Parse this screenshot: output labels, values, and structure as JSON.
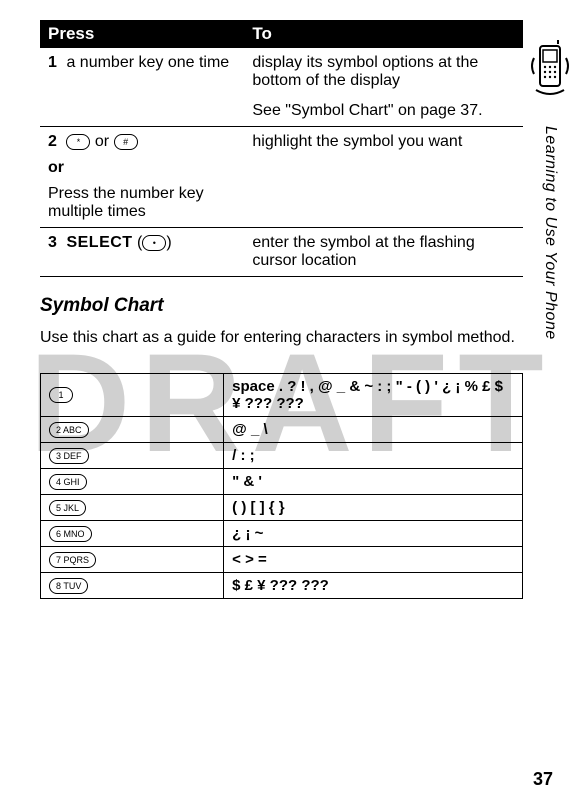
{
  "watermark": "DRAFT",
  "sideText": "Learning to Use Your Phone",
  "pageNumber": "37",
  "pressTable": {
    "headers": {
      "press": "Press",
      "to": "To"
    },
    "rows": [
      {
        "num": "1",
        "press": "a number key one time",
        "to": "display its symbol options at the bottom of the display",
        "to2": "See \"Symbol Chart\" on page 37."
      },
      {
        "num": "2",
        "keyLeft": "*",
        "keyJoin": " or ",
        "keyRight": "#",
        "orText": "or",
        "press2": "Press the number key multiple times",
        "to": "highlight the symbol you want"
      },
      {
        "num": "3",
        "select": "SELECT",
        "selectKey": "•",
        "to": "enter the symbol at the flashing cursor location"
      }
    ]
  },
  "sectionTitle": "Symbol Chart",
  "sectionDesc": "Use this chart as a guide for entering characters in symbol method.",
  "symbolTable": [
    {
      "key": "1",
      "symbols": "space . ? ! , @ _ & ~ : ; \" - ( ) ' ¿ ¡ % £ $ ¥ ??? ???"
    },
    {
      "key": "2 ABC",
      "symbols": "@ _ \\"
    },
    {
      "key": "3 DEF",
      "symbols": "/ : ;"
    },
    {
      "key": "4 GHI",
      "symbols": "\" & '"
    },
    {
      "key": "5 JKL",
      "symbols": "( ) [ ] { }"
    },
    {
      "key": "6 MNO",
      "symbols": "¿ ¡ ~"
    },
    {
      "key": "7 PQRS",
      "symbols": "< > ="
    },
    {
      "key": "8 TUV",
      "symbols": "$ £ ¥ ??? ???"
    }
  ]
}
